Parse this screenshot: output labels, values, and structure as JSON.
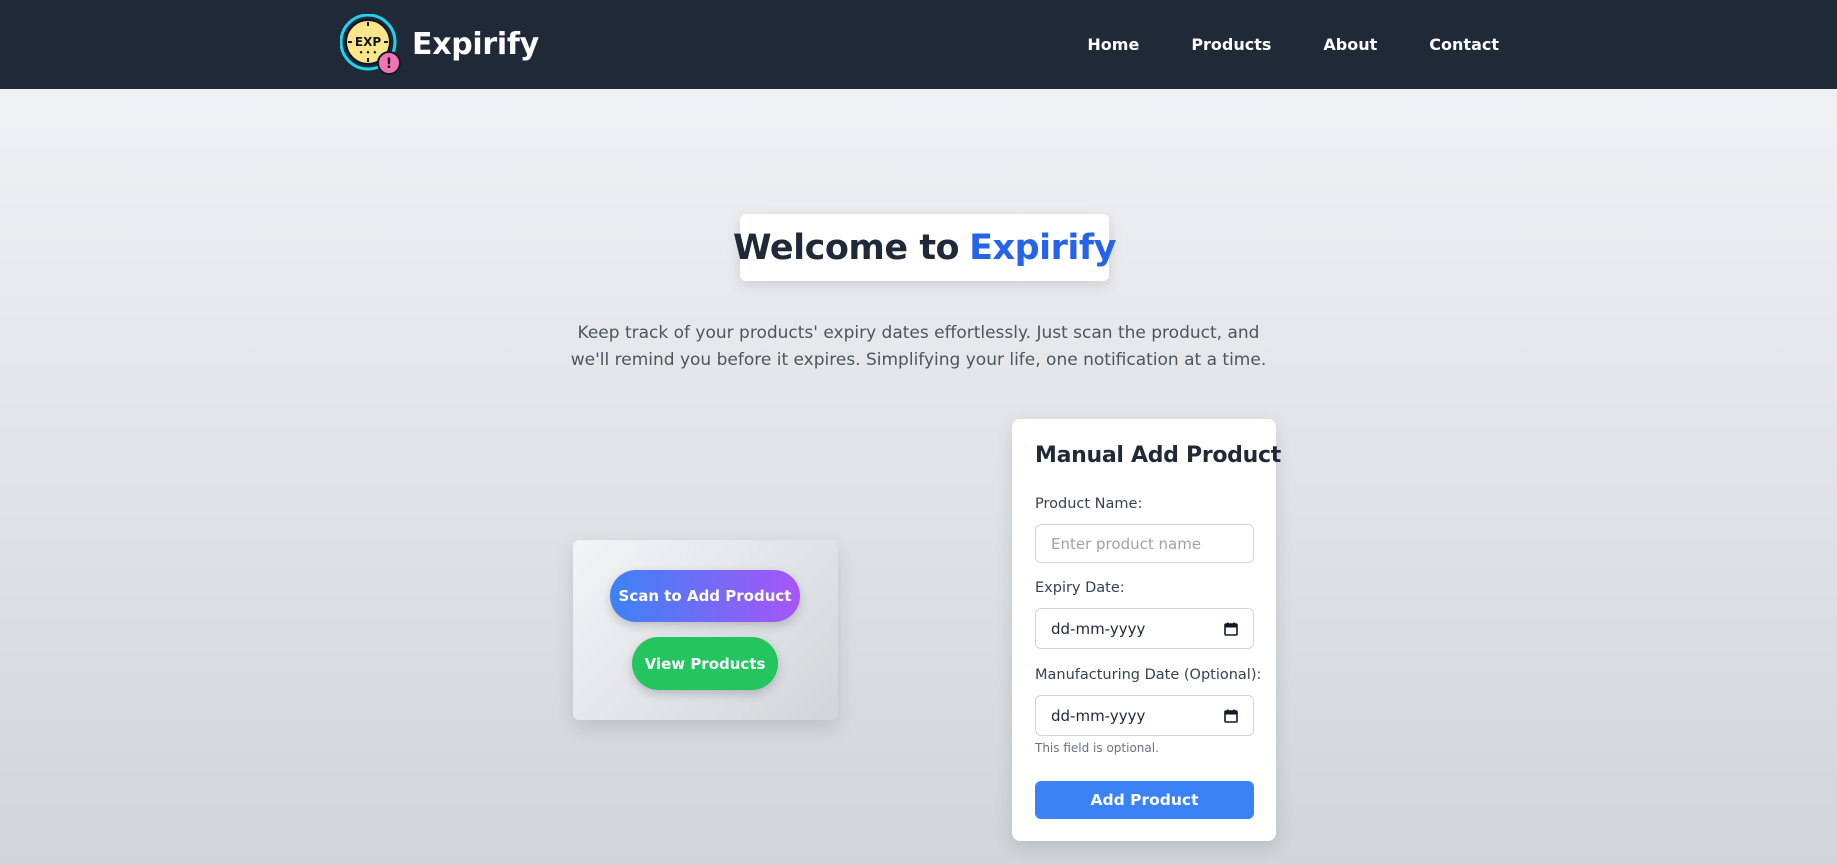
{
  "header": {
    "brand": "Expirify",
    "logo_text": "EXP",
    "logo_alert": "!",
    "nav": [
      {
        "label": "Home"
      },
      {
        "label": "Products"
      },
      {
        "label": "About"
      },
      {
        "label": "Contact"
      }
    ]
  },
  "hero": {
    "title_lead": "Welcome to",
    "title_accent": "Expirify",
    "subtitle": "Keep track of your products' expiry dates effortlessly. Just scan the product, and we'll remind you before it expires. Simplifying your life, one notification at a time."
  },
  "actions": {
    "scan_label": "Scan to Add Product",
    "view_label": "View Products"
  },
  "form": {
    "title": "Manual Add Product",
    "product_name_label": "Product Name:",
    "product_name_placeholder": "Enter product name",
    "expiry_label": "Expiry Date:",
    "expiry_value": "dd-mm-yyyy",
    "mfg_label": "Manufacturing Date (Optional):",
    "mfg_value": "dd-mm-yyyy",
    "hint": "This field is optional.",
    "submit_label": "Add Product"
  },
  "colors": {
    "navbar": "#1f2937",
    "accent": "#2563eb",
    "primary_button": "#3b82f6",
    "success_button": "#22c55e",
    "gradient_start": "#3b82f6",
    "gradient_end": "#a855f7"
  },
  "icons": {
    "logo": "expiry-clock-icon",
    "alert": "alert-icon",
    "calendar": "calendar-icon"
  }
}
